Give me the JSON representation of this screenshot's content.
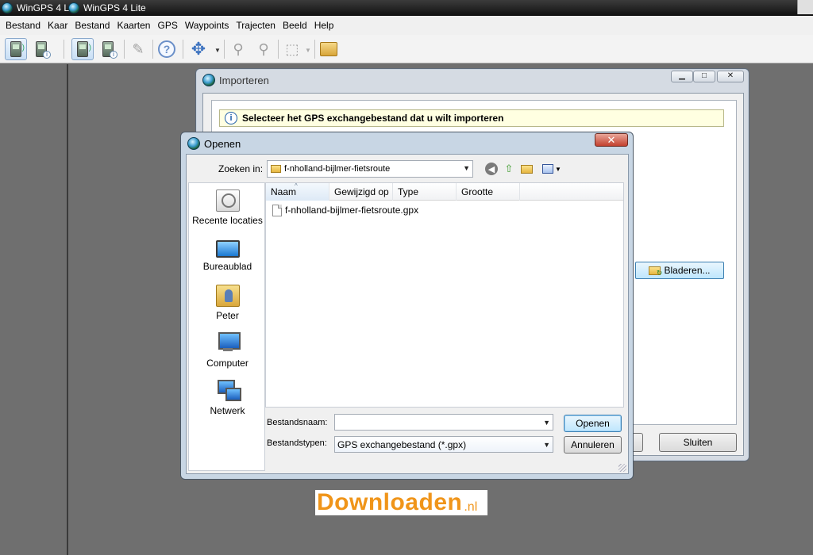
{
  "app": {
    "title_tabs": [
      "WinGPS 4 L",
      "WinGPS 4 Lite"
    ]
  },
  "menubar": {
    "items": [
      "Bestand",
      "Kaar",
      "Bestand",
      "Kaarten",
      "GPS",
      "Waypoints",
      "Trajecten",
      "Beeld",
      "Help"
    ]
  },
  "import_window": {
    "title": "Importeren",
    "banner_text": "Selecteer het GPS exchangebestand dat u wilt importeren",
    "browse_label": "Bladeren...",
    "close_label": "Sluiten"
  },
  "open_dialog": {
    "title": "Openen",
    "close_glyph": "✕",
    "lookin_label": "Zoeken in:",
    "lookin_value": "f-nholland-bijlmer-fietsroute",
    "places": [
      "Recente locaties",
      "Bureaublad",
      "Peter",
      "Computer",
      "Netwerk"
    ],
    "columns": [
      "Naam",
      "Gewijzigd op",
      "Type",
      "Grootte"
    ],
    "files": [
      "f-nholland-bijlmer-fietsroute.gpx"
    ],
    "filename_label": "Bestandsnaam:",
    "filename_value": "",
    "filetype_label": "Bestandstypen:",
    "filetype_value": "GPS exchangebestand (*.gpx)",
    "open_label": "Openen",
    "cancel_label": "Annuleren"
  },
  "watermark": {
    "text": "Downloaden",
    "tld": ".nl",
    "color": "#f0951a"
  },
  "icons": {
    "toolbar": [
      "gps-receiver-icon",
      "gps-info-icon",
      "gps-receiver-active-icon",
      "gps-info-icon",
      "pen-icon",
      "help-icon",
      "move-icon",
      "zoom-in-icon",
      "zoom-out-icon",
      "frame-icon",
      "box-icon"
    ]
  }
}
